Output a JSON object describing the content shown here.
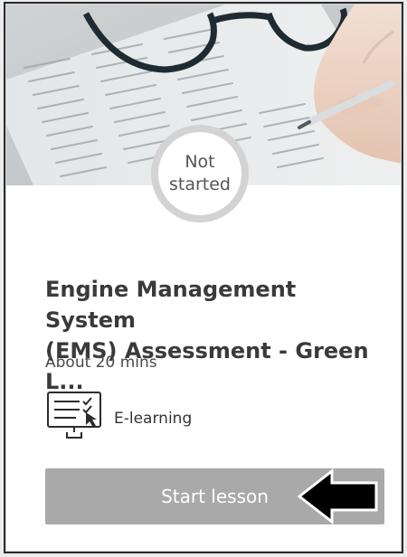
{
  "card": {
    "status": {
      "line1": "Not",
      "line2": "started"
    },
    "title_line1": "Engine Management System",
    "title_line2": "(EMS) Assessment - Green L...",
    "duration": "About 20 mins",
    "type_icon": "elearning-screen-icon",
    "type_label": "E-learning",
    "start_button_label": "Start lesson"
  },
  "colors": {
    "button_disabled": "#a9a9a9",
    "ring": "#d3d3d3",
    "title_text": "#3a3a3a"
  }
}
